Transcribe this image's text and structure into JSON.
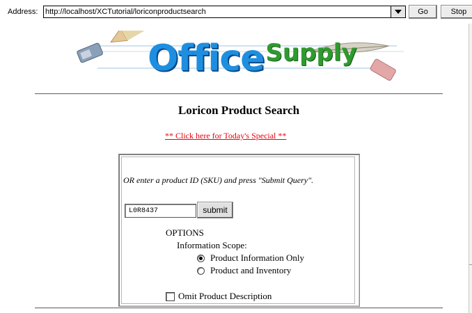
{
  "browser": {
    "address_label": "Address:",
    "url": "http://localhost/XCTutorial/loriconproductsearch",
    "go_label": "Go",
    "stop_label": "Stop"
  },
  "logo": {
    "word1": "Office",
    "word2": "Supply"
  },
  "page": {
    "title": "Loricon Product Search",
    "special_link": "** Click here for Today's Special **"
  },
  "form": {
    "instruction": "OR enter a product ID (SKU) and press \"Submit Query\".",
    "sku_value": "L0R8437",
    "submit_label": "submit",
    "options_heading": "OPTIONS",
    "scope_label": "Information Scope:",
    "radio_options": [
      {
        "label": "Product Information Only",
        "selected": true
      },
      {
        "label": "Product and Inventory",
        "selected": false
      }
    ],
    "omit_description_label": "Omit Product Description",
    "omit_description_checked": false
  },
  "colors": {
    "link": "#e8000b",
    "logo_office": "#1e8fe0",
    "logo_supply": "#2f9a2f"
  }
}
